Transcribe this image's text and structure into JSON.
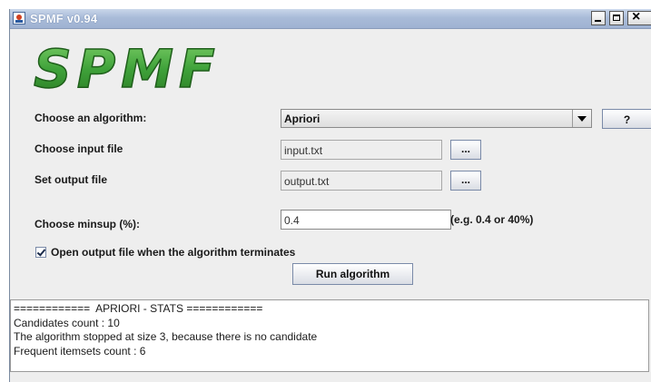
{
  "window": {
    "title": "SPMF v0.94",
    "close_glyph": "×",
    "logo_text": "SPMF"
  },
  "form": {
    "algorithm_label": "Choose an algorithm:",
    "algorithm_value": "Apriori",
    "help_label": "?",
    "input_label": "Choose input file",
    "input_value": "input.txt",
    "output_label": "Set output file",
    "output_value": "output.txt",
    "browse_label": "...",
    "minsup_label": "Choose minsup (%):",
    "minsup_value": "0.4",
    "minsup_hint": "(e.g. 0.4 or 40%)",
    "open_output_label": "Open output file when the algorithm terminates",
    "open_output_checked": true,
    "run_label": "Run algorithm"
  },
  "log": {
    "lines": [
      "============  APRIORI - STATS ============",
      "Candidates count : 10",
      "The algorithm stopped at size 3, because there is no candidate",
      "Frequent itemsets count : 6"
    ]
  },
  "colors": {
    "title_bar": "#a9bbd8",
    "logo_fill": "#3fa23a",
    "logo_outline": "#1e5e1a"
  },
  "icons": [
    "java-app-icon",
    "minimize-icon",
    "maximize-icon",
    "close-icon",
    "dropdown-arrow-icon",
    "checkmark-icon"
  ]
}
